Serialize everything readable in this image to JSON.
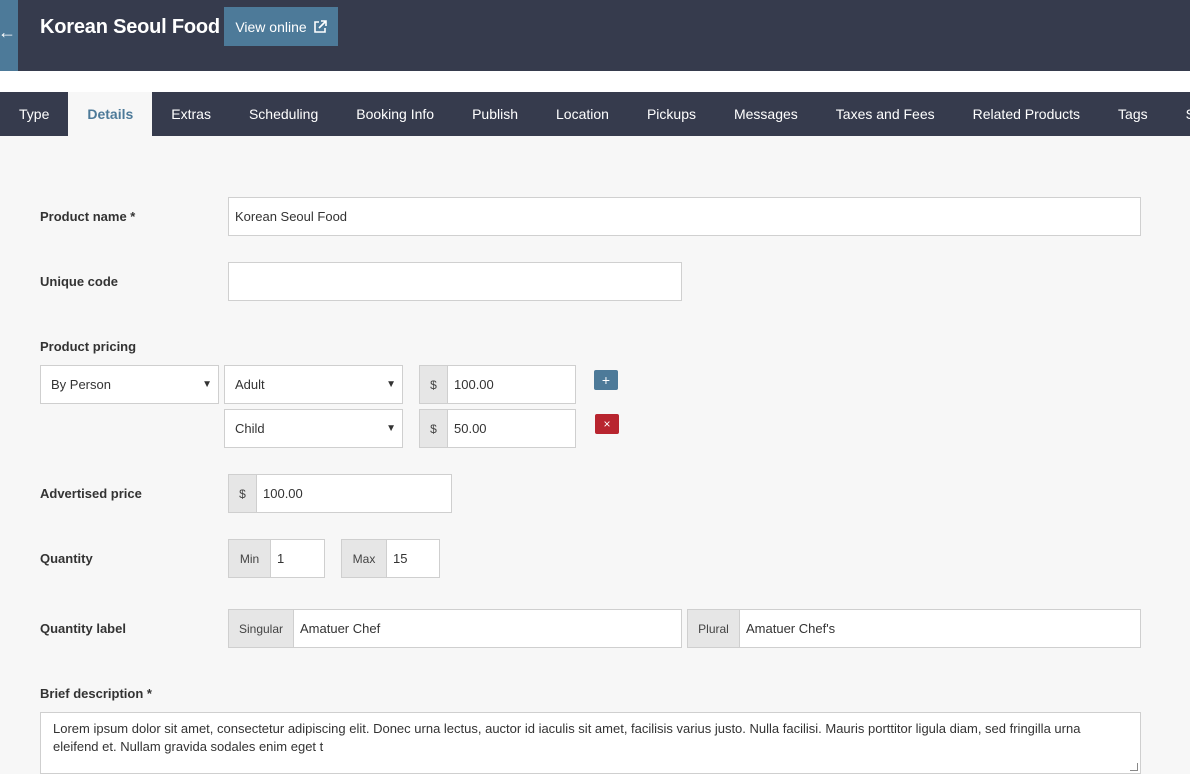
{
  "header": {
    "title": "Korean Seoul Food",
    "view_online": "View online",
    "back_icon": "arrow-left-icon",
    "external_icon": "external-link-icon"
  },
  "tabs": [
    {
      "label": "Type"
    },
    {
      "label": "Details",
      "active": true
    },
    {
      "label": "Extras"
    },
    {
      "label": "Scheduling"
    },
    {
      "label": "Booking Info"
    },
    {
      "label": "Publish"
    },
    {
      "label": "Location"
    },
    {
      "label": "Pickups"
    },
    {
      "label": "Messages"
    },
    {
      "label": "Taxes and Fees"
    },
    {
      "label": "Related Products"
    },
    {
      "label": "Tags"
    },
    {
      "label": "SEO"
    }
  ],
  "form": {
    "product_name": {
      "label": "Product name *",
      "value": "Korean Seoul Food"
    },
    "unique_code": {
      "label": "Unique code",
      "value": ""
    },
    "pricing": {
      "label": "Product pricing",
      "type": "By Person",
      "currency": "$",
      "rows": [
        {
          "category": "Adult",
          "price": "100.00"
        },
        {
          "category": "Child",
          "price": "50.00"
        }
      ],
      "add_symbol": "+",
      "remove_symbol": "×"
    },
    "advertised_price": {
      "label": "Advertised price",
      "currency": "$",
      "value": "100.00"
    },
    "quantity": {
      "label": "Quantity",
      "min_label": "Min",
      "min": "1",
      "max_label": "Max",
      "max": "15"
    },
    "quantity_label": {
      "label": "Quantity label",
      "singular_label": "Singular",
      "singular": "Amatuer Chef",
      "plural_label": "Plural",
      "plural": "Amatuer Chef's"
    },
    "brief_description": {
      "label": "Brief description *",
      "value": "Lorem ipsum dolor sit amet, consectetur adipiscing elit. Donec urna lectus, auctor id iaculis sit amet, facilisis varius justo. Nulla facilisi. Mauris porttitor ligula diam, sed fringilla urna eleifend et. Nullam gravida sodales enim eget t"
    }
  },
  "colors": {
    "header_bg": "#363b4d",
    "accent": "#4d7a99",
    "danger": "#b8252f"
  }
}
